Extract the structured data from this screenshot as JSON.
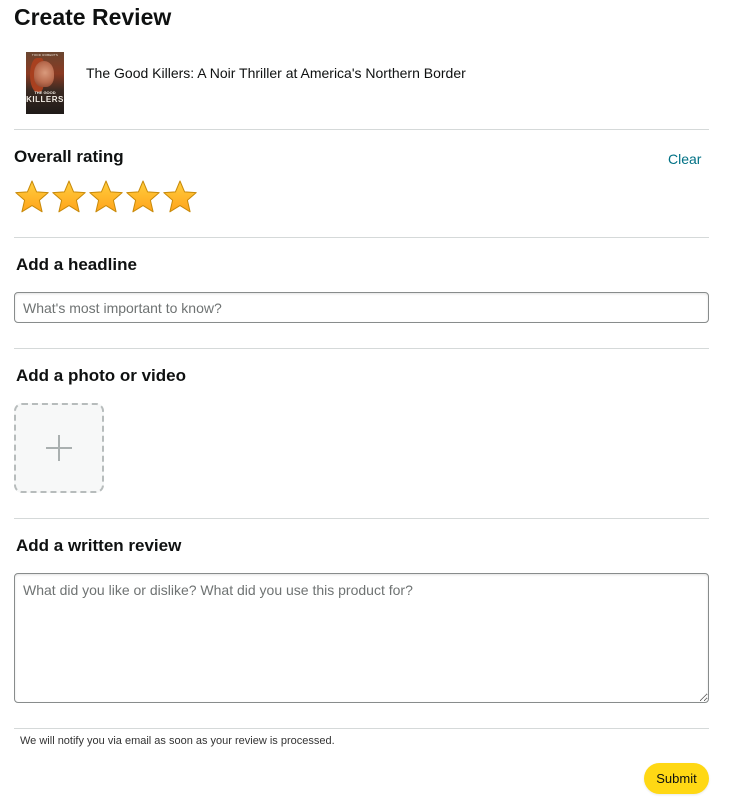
{
  "page": {
    "title": "Create Review"
  },
  "product": {
    "title": "The Good Killers: A Noir Thriller at America's Northern Border",
    "cover_author": "TODD ROBERTS",
    "cover_title_line1": "THE GOOD",
    "cover_title_line2": "KILLERS"
  },
  "rating": {
    "heading": "Overall rating",
    "clear_label": "Clear",
    "value": 5,
    "max": 5,
    "star_color": "#ffa41c"
  },
  "headline": {
    "heading": "Add a headline",
    "placeholder": "What's most important to know?",
    "value": ""
  },
  "media": {
    "heading": "Add a photo or video",
    "icon": "plus-icon"
  },
  "review": {
    "heading": "Add a written review",
    "placeholder": "What did you like or dislike? What did you use this product for?",
    "value": ""
  },
  "footer": {
    "notice": "We will notify you via email as soon as your review is processed.",
    "submit_label": "Submit",
    "submit_color": "#ffd814"
  }
}
